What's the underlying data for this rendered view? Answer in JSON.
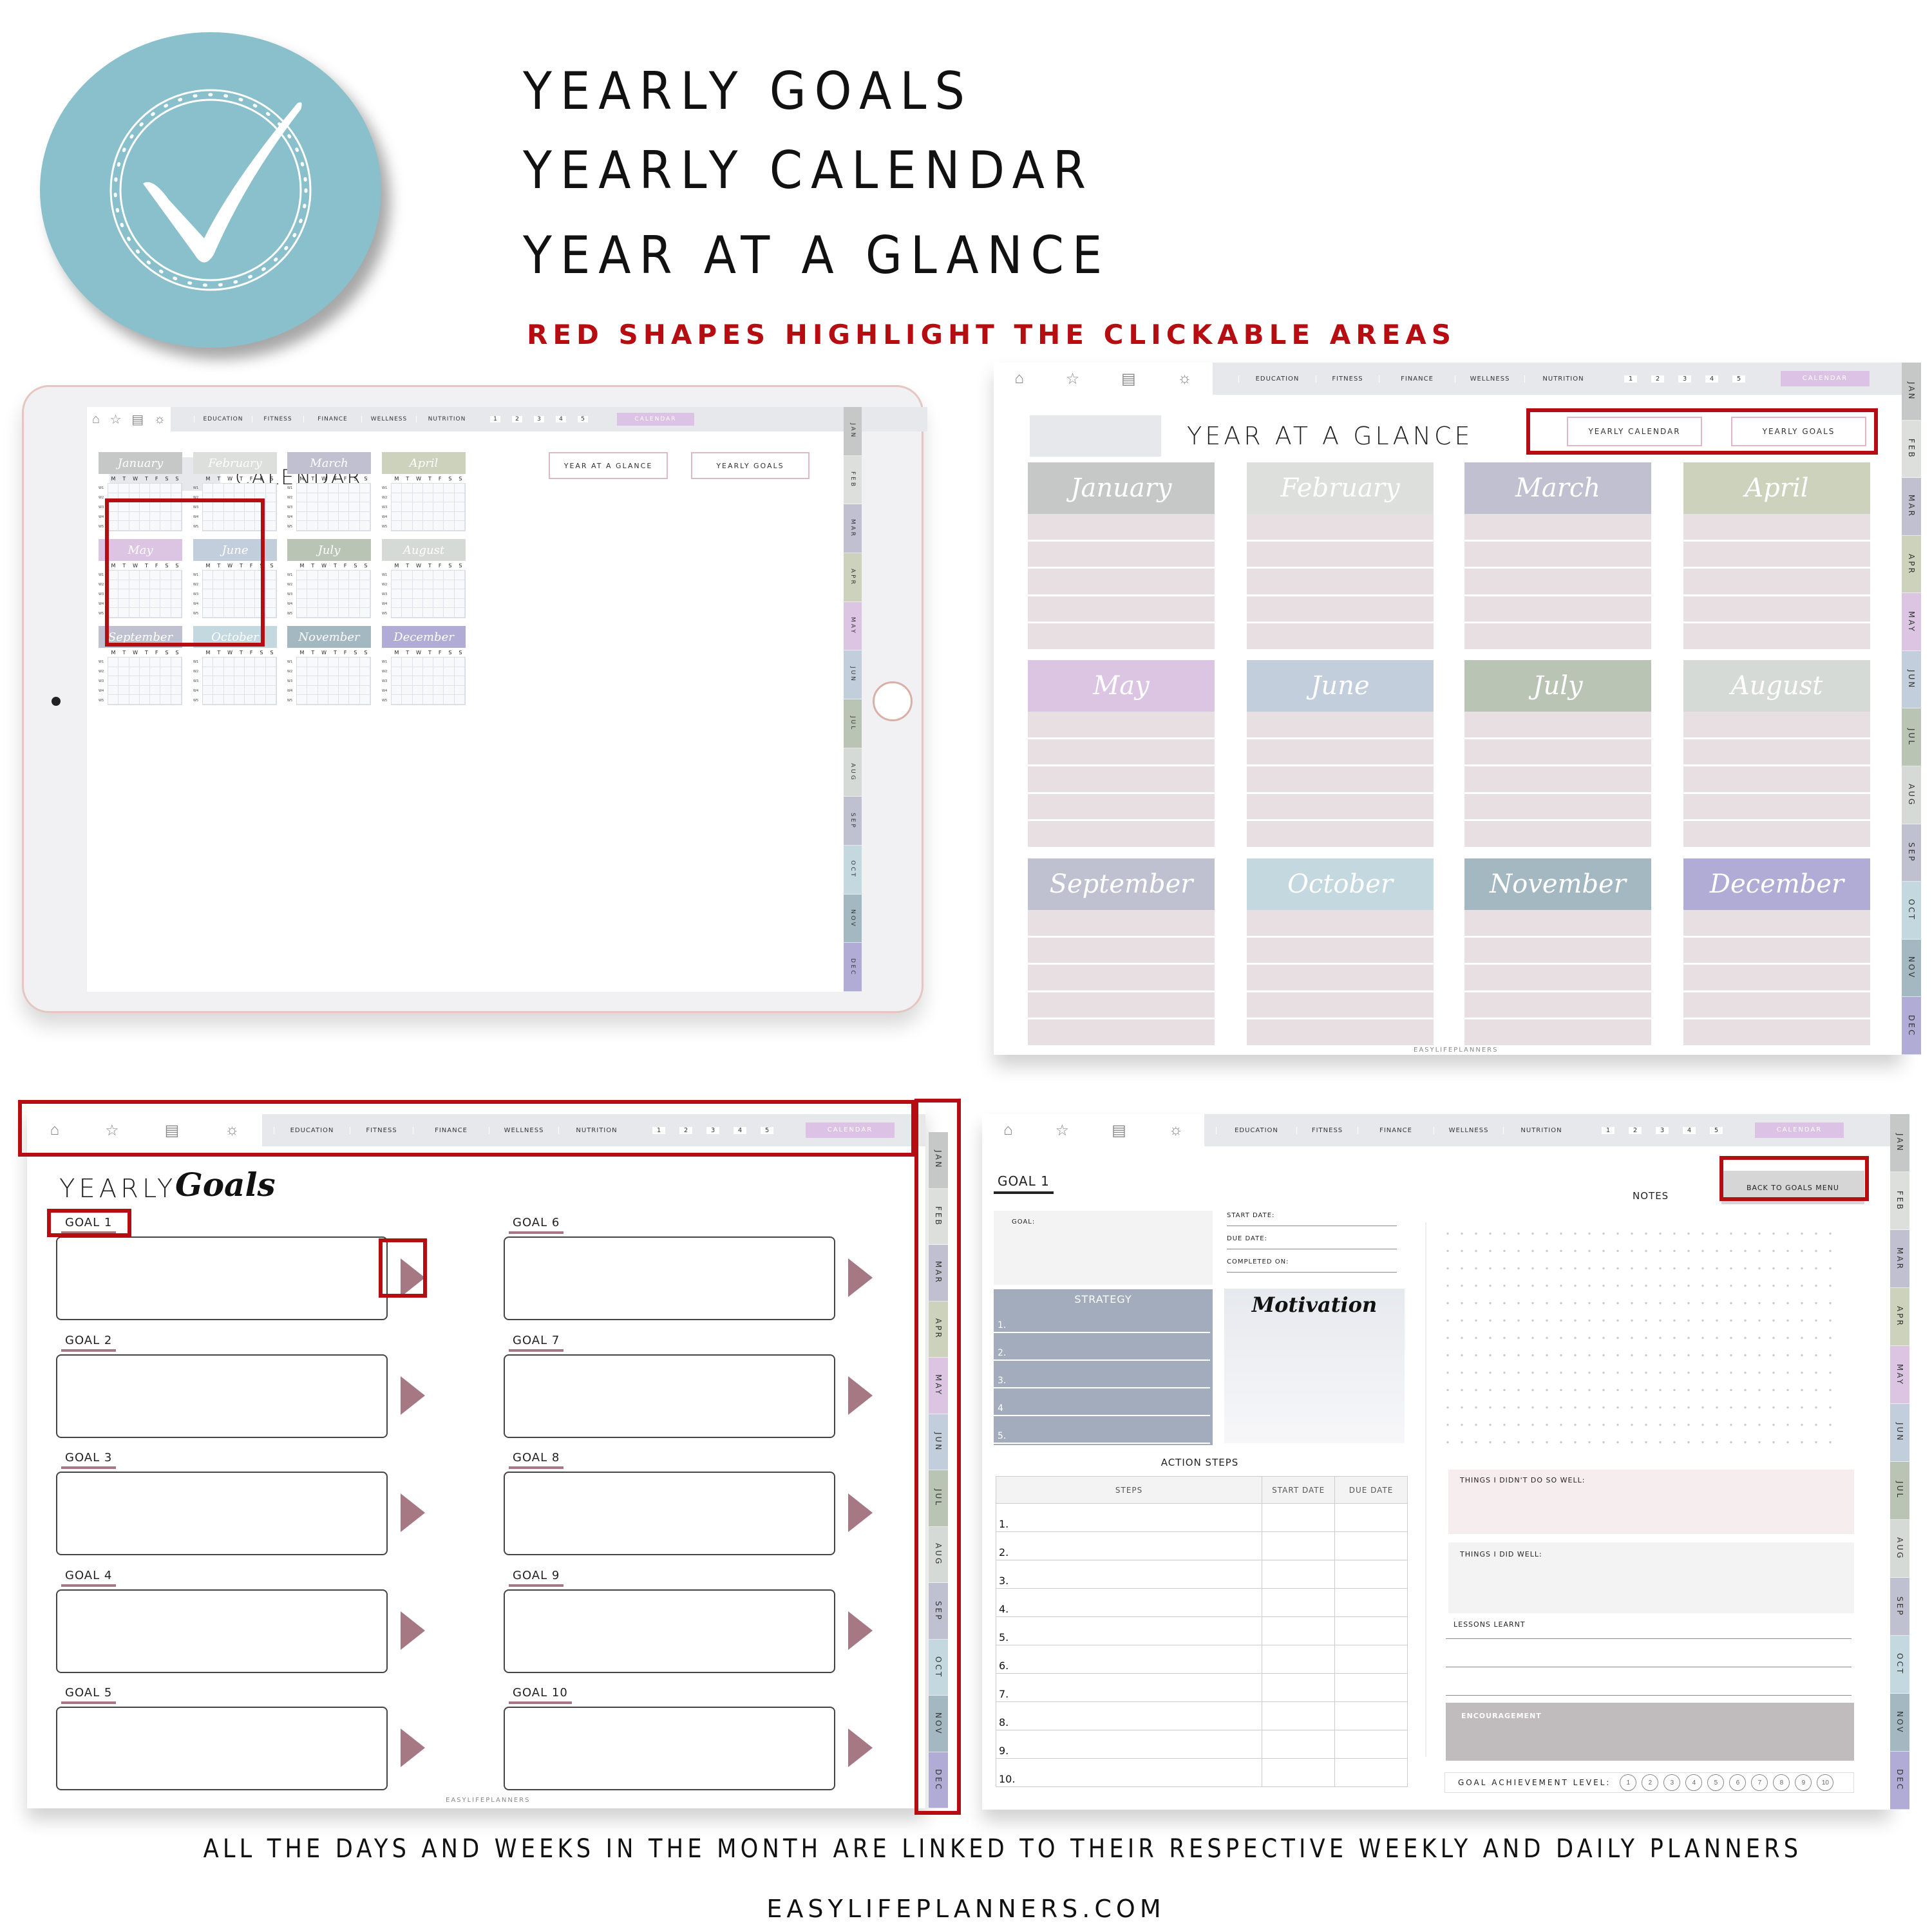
{
  "headlines": [
    "YEARLY GOALS",
    "YEARLY CALENDAR",
    "YEAR AT A GLANCE"
  ],
  "subheadline": "RED SHAPES HIGHLIGHT THE CLICKABLE AREAS",
  "badge_icon": "checkmark-icon",
  "colors": {
    "highlight_red": "#b50d12",
    "badge": "#89c0cc",
    "calendar_btn": "#dcc2e4",
    "goal_accent": "#a57883"
  },
  "nav": {
    "icons": [
      "home-icon",
      "star-icon",
      "notepad-icon",
      "lightbulb-icon"
    ],
    "links": [
      "EDUCATION",
      "FITNESS",
      "FINANCE",
      "WELLNESS",
      "NUTRITION"
    ],
    "numbers": [
      "1",
      "2",
      "3",
      "4",
      "5"
    ],
    "calendar": "CALENDAR"
  },
  "month_tabs": [
    {
      "label": "JAN",
      "color": "#c6c8c8"
    },
    {
      "label": "FEB",
      "color": "#dcdfdc"
    },
    {
      "label": "MAR",
      "color": "#c0c0d0"
    },
    {
      "label": "APR",
      "color": "#cdd2bc"
    },
    {
      "label": "MAY",
      "color": "#dcc5e3"
    },
    {
      "label": "JUN",
      "color": "#c3cedc"
    },
    {
      "label": "JUL",
      "color": "#bac4b4"
    },
    {
      "label": "AUG",
      "color": "#d6dad6"
    },
    {
      "label": "SEP",
      "color": "#c0c1d0"
    },
    {
      "label": "OCT",
      "color": "#c4d8e0"
    },
    {
      "label": "NOV",
      "color": "#a4b8c2"
    },
    {
      "label": "DEC",
      "color": "#b1acd6"
    }
  ],
  "months": [
    {
      "name": "January",
      "color": "#c6c8c8"
    },
    {
      "name": "February",
      "color": "#dcdfdc"
    },
    {
      "name": "March",
      "color": "#c0c0d0"
    },
    {
      "name": "April",
      "color": "#cdd2bc"
    },
    {
      "name": "May",
      "color": "#dcc5e3"
    },
    {
      "name": "June",
      "color": "#c3cedc"
    },
    {
      "name": "July",
      "color": "#bac4b4"
    },
    {
      "name": "August",
      "color": "#d6dad6"
    },
    {
      "name": "September",
      "color": "#c0c1d0"
    },
    {
      "name": "October",
      "color": "#c4d8e0"
    },
    {
      "name": "November",
      "color": "#a4b8c2"
    },
    {
      "name": "December",
      "color": "#b1acd6"
    }
  ],
  "calendar_page": {
    "title": "CALENDAR",
    "buttons": [
      "YEAR AT A GLANCE",
      "YEARLY GOALS"
    ],
    "weekdays": [
      "M",
      "T",
      "W",
      "T",
      "F",
      "S",
      "S"
    ],
    "weeks": [
      "W1",
      "W2",
      "W3",
      "W4",
      "W5"
    ]
  },
  "glance_page": {
    "title": "YEAR AT A GLANCE",
    "buttons": [
      "YEARLY CALENDAR",
      "YEARLY GOALS"
    ],
    "footer": "EASYLIFEPLANNERS"
  },
  "goals_page": {
    "title_plain": "YEARLY",
    "title_script": "Goals",
    "goals": [
      "GOAL 1",
      "GOAL 2",
      "GOAL 3",
      "GOAL 4",
      "GOAL 5",
      "GOAL 6",
      "GOAL 7",
      "GOAL 8",
      "GOAL 9",
      "GOAL 10"
    ],
    "footer": "EASYLIFEPLANNERS"
  },
  "goal_detail": {
    "title": "GOAL 1",
    "back_button": "BACK TO GOALS MENU",
    "notes": "NOTES",
    "goal_label": "GOAL:",
    "date_fields": [
      "START DATE:",
      "DUE DATE:",
      "COMPLETED ON:"
    ],
    "strategy": "STRATEGY",
    "strategy_items": [
      "1.",
      "2.",
      "3.",
      "4",
      "5."
    ],
    "motivation": "Motivation",
    "action_steps": "ACTION STEPS",
    "table_headers": [
      "STEPS",
      "START DATE",
      "DUE DATE"
    ],
    "table_rows": [
      "1.",
      "2.",
      "3.",
      "4.",
      "5.",
      "6.",
      "7.",
      "8.",
      "9.",
      "10."
    ],
    "didnt_well": "THINGS I DIDN'T DO SO WELL:",
    "did_well": "THINGS I DID WELL:",
    "lessons": "LESSONS LEARNT",
    "encouragement": "ENCOURAGEMENT",
    "achievement_label": "GOAL ACHIEVEMENT LEVEL:",
    "achievement_levels": [
      "1",
      "2",
      "3",
      "4",
      "5",
      "6",
      "7",
      "8",
      "9",
      "10"
    ]
  },
  "bottom_caption": "ALL THE DAYS AND WEEKS IN THE MONTH ARE LINKED TO THEIR RESPECTIVE WEEKLY AND DAILY PLANNERS",
  "website": "EASYLIFEPLANNERS.COM"
}
